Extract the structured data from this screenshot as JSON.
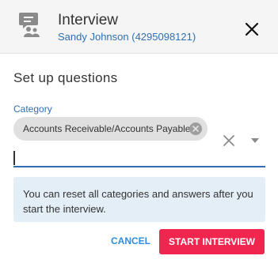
{
  "header": {
    "title": "Interview",
    "subtitle": "Sandy Johnson (4295098121)",
    "icon": "interview-chat-icon",
    "close_icon": "close-icon"
  },
  "section": {
    "title": "Set up questions"
  },
  "category": {
    "label": "Category",
    "selected_chip": "Accounts Receivable/Accounts Payable",
    "input_value": "",
    "accent_color": "#2e6fb4"
  },
  "info": {
    "text": "You can reset all categories and answers after you start the interview."
  },
  "actions": {
    "cancel_label": "CANCEL",
    "start_label": "START INTERVIEW",
    "start_color": "#f0264f"
  }
}
